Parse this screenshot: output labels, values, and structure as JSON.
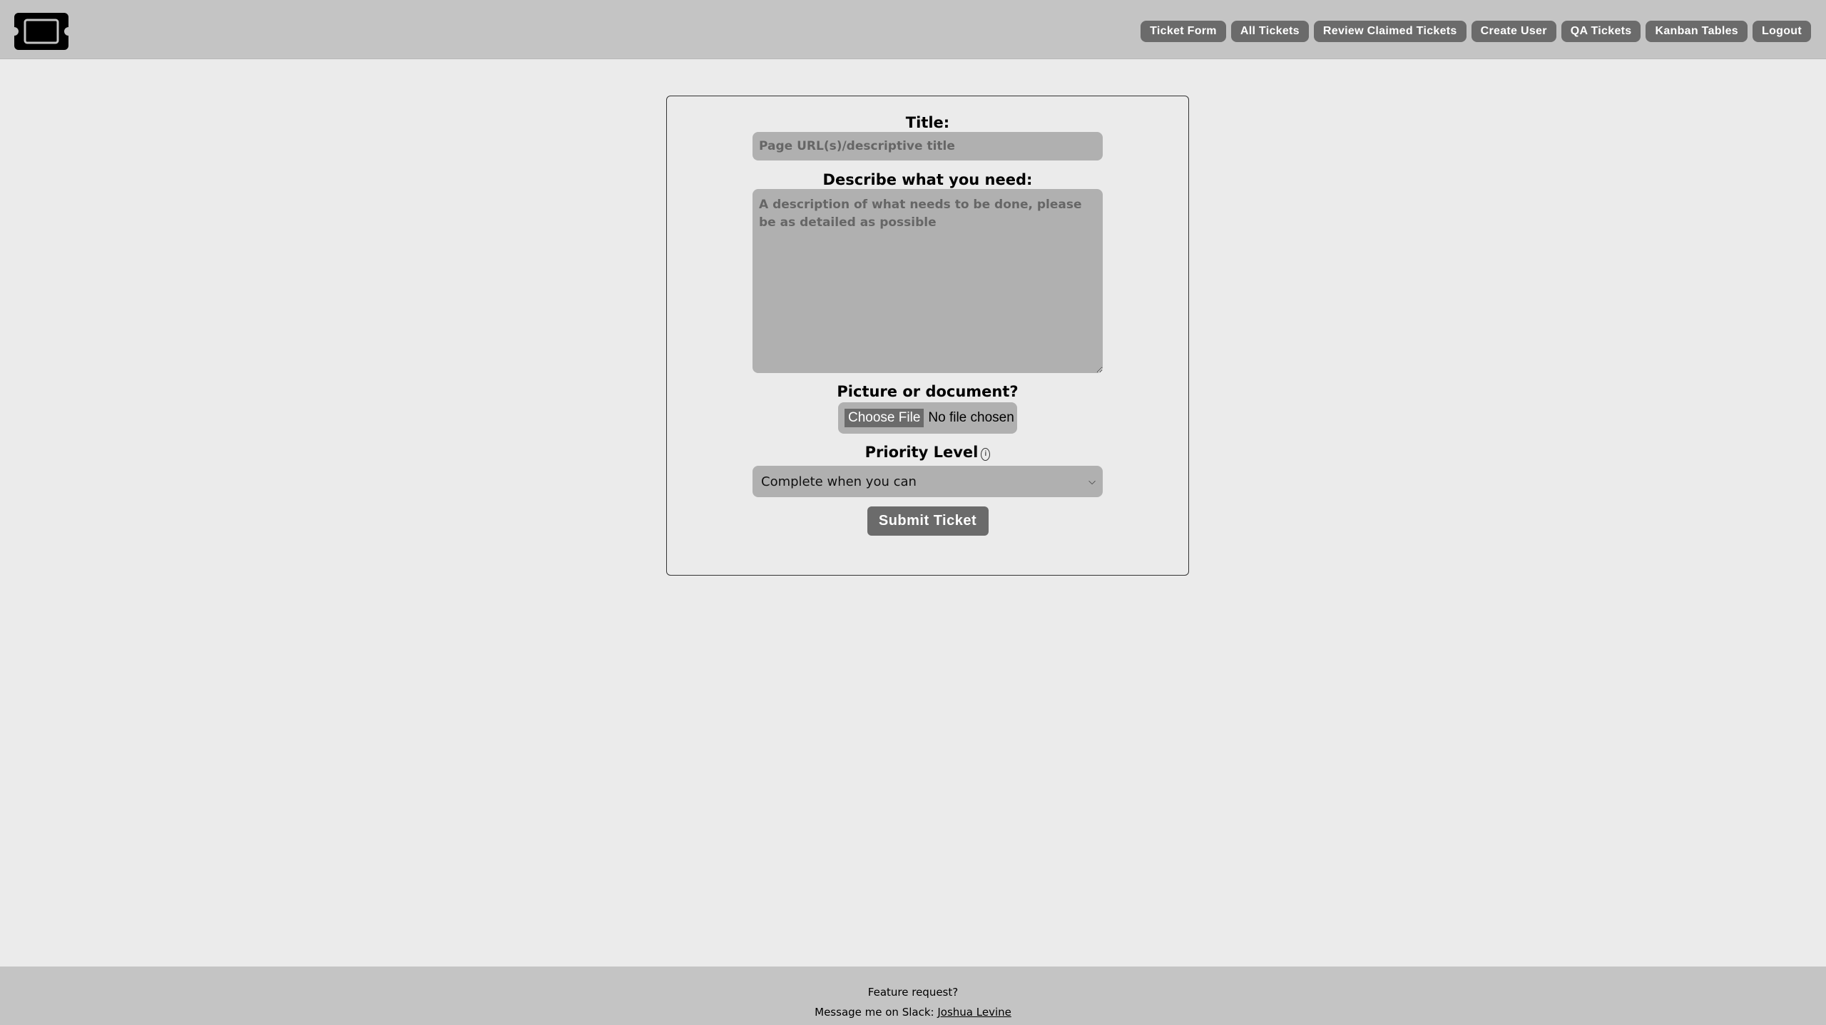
{
  "header": {
    "logo_icon": "ticket-icon",
    "nav": [
      "Ticket Form",
      "All Tickets",
      "Review Claimed Tickets",
      "Create User",
      "QA Tickets",
      "Kanban Tables",
      "Logout"
    ]
  },
  "form": {
    "title_label": "Title:",
    "title_placeholder": "Page URL(s)/descriptive title",
    "description_label": "Describe what you need:",
    "description_placeholder": "A description of what needs to be done, please be as detailed as possible",
    "file_label": "Picture or document?",
    "file_button": "Choose File",
    "file_status": "No file chosen",
    "priority_label": "Priority Level",
    "priority_icon": "info-icon",
    "priority_value": "Complete when you can",
    "submit": "Submit Ticket"
  },
  "footer": {
    "line1": "Feature request?",
    "line2_prefix": "Message me on Slack: ",
    "link": "Joshua Levine"
  },
  "colors": {
    "header": "#c4c4c4",
    "background": "#ebebeb",
    "button": "#6b6b6b",
    "input": "#b0b0b0"
  }
}
